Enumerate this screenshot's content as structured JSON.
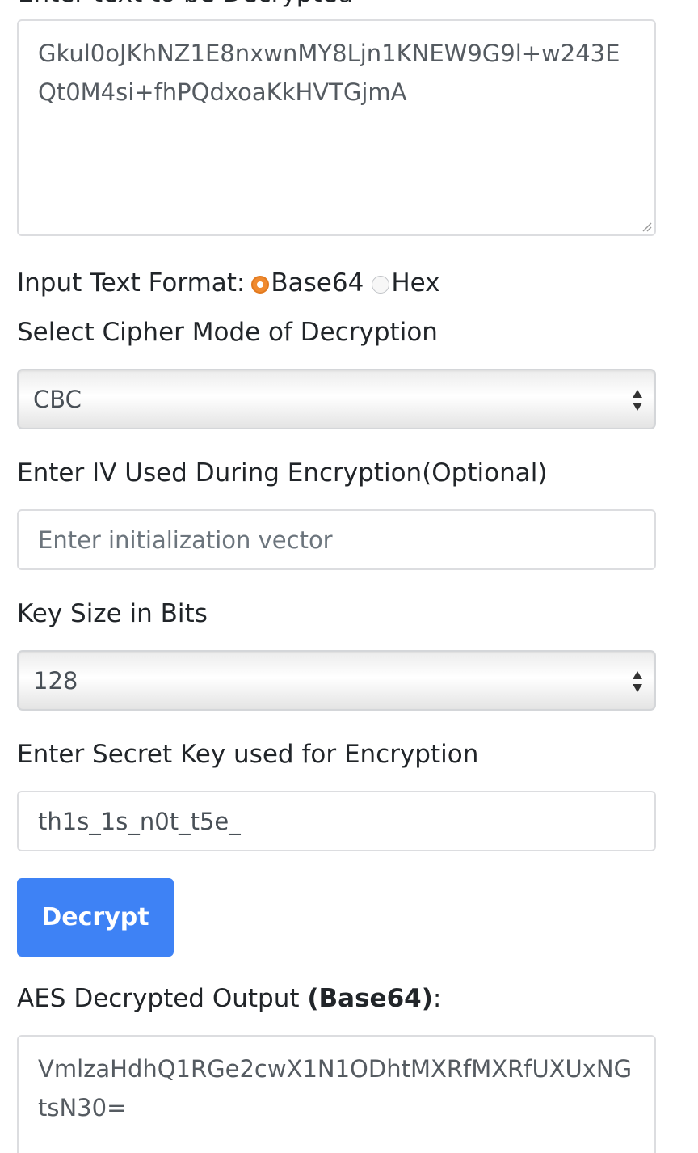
{
  "ciphertext_section": {
    "label_partial": "Enter text to be Decrypted",
    "value": "Gkul0oJKhNZ1E8nxwnMY8Ljn1KNEW9G9l+w243EQt0M4si+fhPQdxoaKkHVTGjmA"
  },
  "input_format": {
    "label": "Input Text Format:",
    "options": [
      {
        "label": "Base64",
        "selected": true
      },
      {
        "label": "Hex",
        "selected": false
      }
    ]
  },
  "cipher_mode": {
    "label": "Select Cipher Mode of Decryption",
    "selected": "CBC"
  },
  "iv": {
    "label": "Enter IV Used During Encryption(Optional)",
    "placeholder": "Enter initialization vector",
    "value": ""
  },
  "key_size": {
    "label": "Key Size in Bits",
    "selected": "128"
  },
  "secret_key": {
    "label": "Enter Secret Key used for Encryption",
    "value": "th1s_1s_n0t_t5e_"
  },
  "decrypt_button": {
    "label": "Decrypt"
  },
  "output": {
    "label_prefix": "AES Decrypted Output ",
    "label_format": "(Base64)",
    "label_suffix": ":",
    "value": "VmlzaHdhQ1RGe2cwX1N1ODhtMXRfMXRfUXUxNGtsN30="
  },
  "colors": {
    "accent_radio": "#f08a2e",
    "button_bg": "#3e82f5"
  }
}
